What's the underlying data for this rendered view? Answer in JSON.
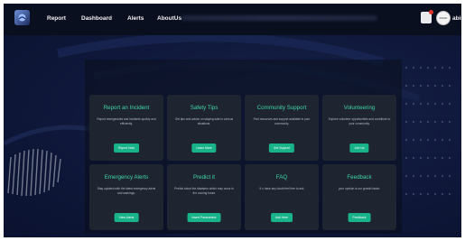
{
  "navbar": {
    "links": [
      "Report",
      "Dashboard",
      "Alerts",
      "AboutUs"
    ],
    "user_name": "abin",
    "avatar_text": "ROAD"
  },
  "cards": [
    {
      "title": "Report an Incident",
      "description": "Report emergencies and incidents quickly and efficiently.",
      "button": "Report Now"
    },
    {
      "title": "Safety Tips",
      "description": "Get tips and advice on staying safe in various situations.",
      "button": "Learn More"
    },
    {
      "title": "Community Support",
      "description": "Find resources and support available in your community.",
      "button": "Get Support"
    },
    {
      "title": "Volunteering",
      "description": "Explore volunteer opportunities and contribute to your community.",
      "button": "Join Us"
    },
    {
      "title": "Emergency Alerts",
      "description": "Stay updated with the latest emergency alerts and warnings.",
      "button": "View Alerts"
    },
    {
      "title": "Predict it",
      "description": "Predict about the disasters which may occur in the coming future",
      "button": "Insert Parameters"
    },
    {
      "title": "FAQ",
      "description": "If u have any doubt feel free to ask",
      "button": "Ask Here"
    },
    {
      "title": "Feedback",
      "description": "your opinion is our growth factor.",
      "button": "Feedback"
    }
  ],
  "colors": {
    "accent": "#18b389",
    "card_title": "#3fd6a8",
    "card_bg": "#1f2530",
    "navbar_bg": "#0a0f20",
    "page_bg": "#0d1530"
  },
  "icons": [
    "app-logo-icon",
    "notification-icon",
    "avatar"
  ]
}
